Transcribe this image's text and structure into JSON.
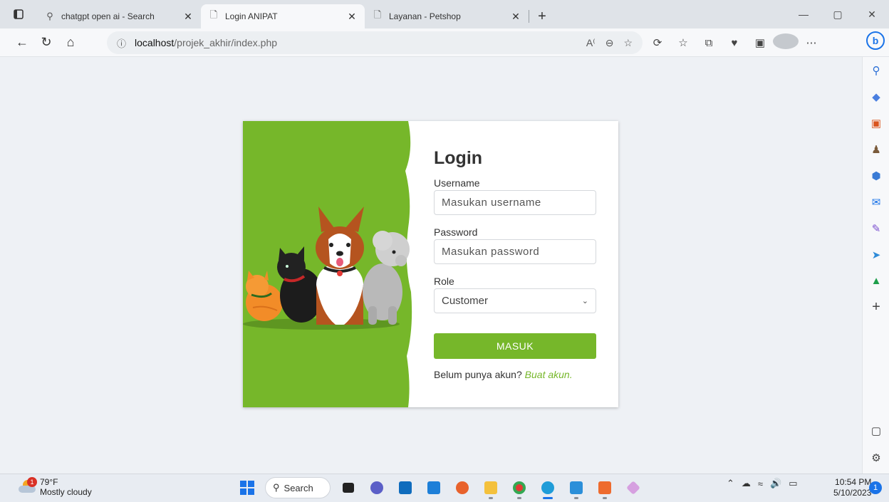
{
  "tabs": [
    {
      "label": "chatgpt open ai - Search",
      "icon": "search-icon",
      "active": false
    },
    {
      "label": "Login ANIPAT",
      "icon": "page-icon",
      "active": true
    },
    {
      "label": "Layanan - Petshop",
      "icon": "page-icon",
      "active": false
    }
  ],
  "address": {
    "host": "localhost",
    "path": "/projek_akhir/index.php"
  },
  "login": {
    "title": "Login",
    "username_label": "Username",
    "username_placeholder": "Masukan username",
    "password_label": "Password",
    "password_placeholder": "Masukan password",
    "role_label": "Role",
    "role_value": "Customer",
    "submit_label": "MASUK",
    "signup_text": "Belum punya akun?",
    "signup_link": "Buat akun."
  },
  "taskbar": {
    "weather_temp": "79°F",
    "weather_desc": "Mostly cloudy",
    "weather_badge": "1",
    "search_label": "Search",
    "time": "10:54 PM",
    "date": "5/10/2023",
    "notif_count": "1"
  },
  "colors": {
    "accent_green": "#76b72a",
    "page_bg": "#eef1f5"
  }
}
